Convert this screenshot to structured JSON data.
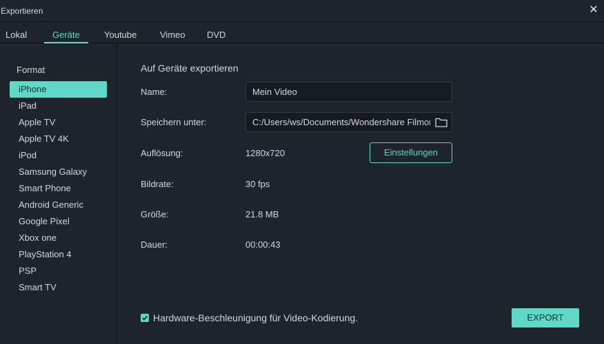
{
  "window": {
    "title": "Exportieren",
    "close_icon": "close-icon"
  },
  "tabs": [
    {
      "label": "Lokal",
      "active": false
    },
    {
      "label": "Geräte",
      "active": true
    },
    {
      "label": "Youtube",
      "active": false
    },
    {
      "label": "Vimeo",
      "active": false
    },
    {
      "label": "DVD",
      "active": false
    }
  ],
  "sidebar": {
    "heading": "Format",
    "selected": "iPhone",
    "items": [
      {
        "label": "iPhone"
      },
      {
        "label": "iPad"
      },
      {
        "label": "Apple TV"
      },
      {
        "label": "Apple TV 4K"
      },
      {
        "label": "iPod"
      },
      {
        "label": "Samsung Galaxy"
      },
      {
        "label": "Smart Phone"
      },
      {
        "label": "Android Generic"
      },
      {
        "label": "Google Pixel"
      },
      {
        "label": "Xbox one"
      },
      {
        "label": "PlayStation 4"
      },
      {
        "label": "PSP"
      },
      {
        "label": "Smart TV"
      }
    ]
  },
  "main": {
    "section_title": "Auf Geräte exportieren",
    "name": {
      "label": "Name:",
      "value": "Mein Video"
    },
    "save_to": {
      "label": "Speichern unter:",
      "value": "C:/Users/ws/Documents/Wondershare Filmora",
      "icon": "folder-icon"
    },
    "resolution": {
      "label": "Auflösung:",
      "value": "1280x720",
      "button": "Einstellungen"
    },
    "framerate": {
      "label": "Bildrate:",
      "value": "30 fps"
    },
    "size": {
      "label": "Größe:",
      "value": "21.8 MB"
    },
    "duration": {
      "label": "Dauer:",
      "value": "00:00:43"
    }
  },
  "footer": {
    "hw_accel_label": "Hardware-Beschleunigung für Video-Kodierung.",
    "hw_accel_checked": true,
    "export_button": "EXPORT"
  },
  "colors": {
    "accent": "#5fd8c8",
    "background": "#1e242c",
    "text": "#d3d7dc"
  }
}
